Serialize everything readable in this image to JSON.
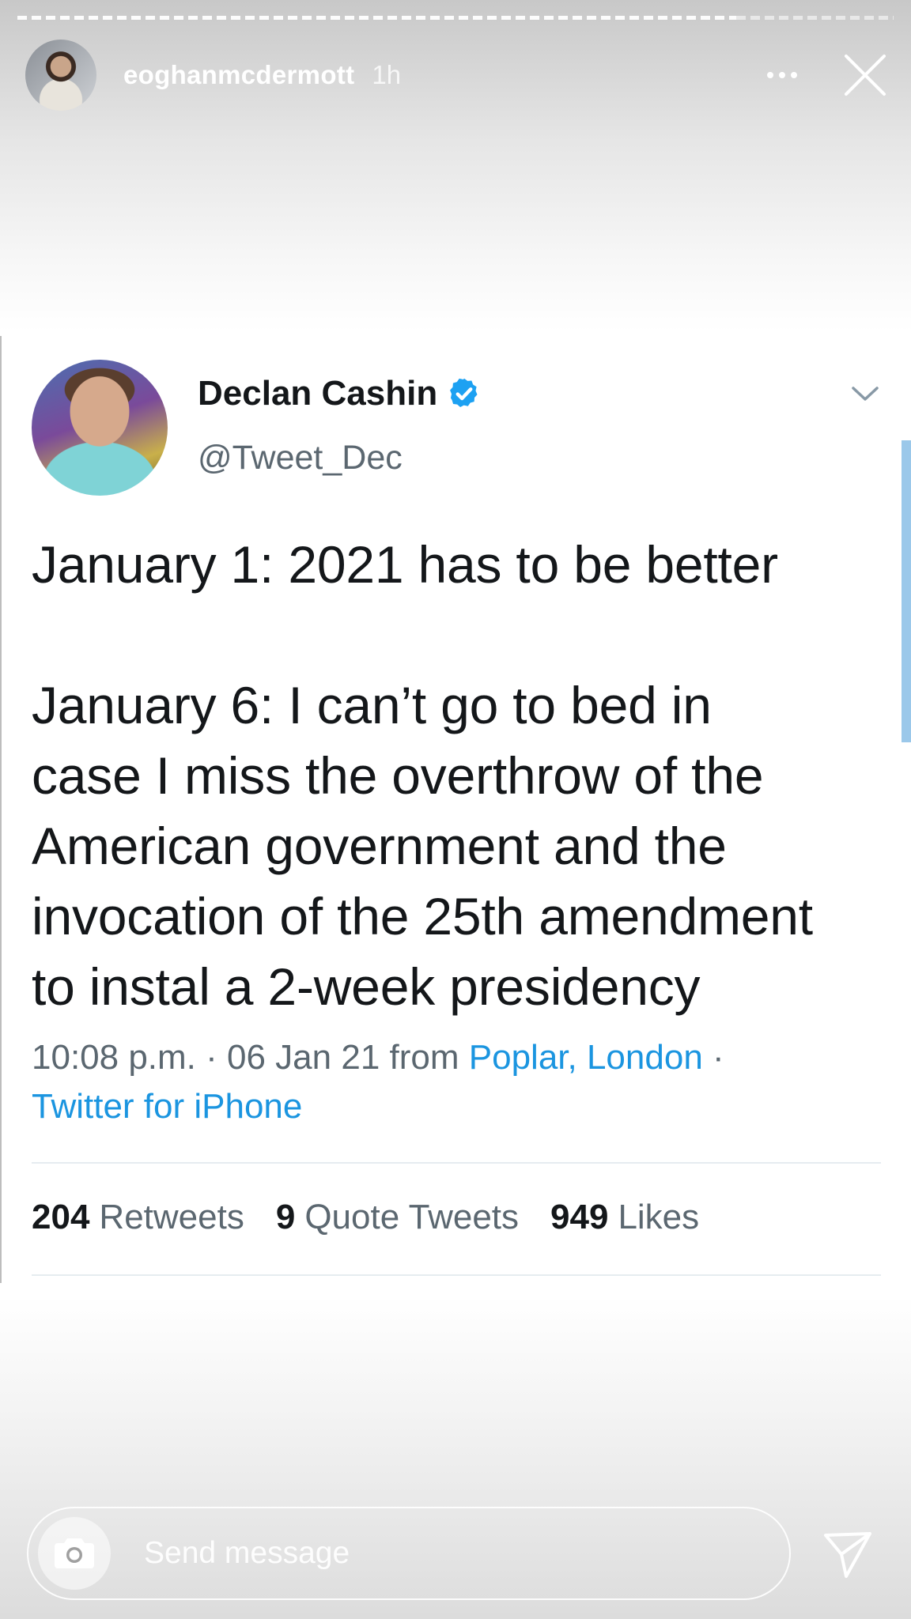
{
  "story": {
    "progress": 0.82,
    "username": "eoghanmcdermott",
    "time": "1h"
  },
  "tweet": {
    "name": "Declan Cashin",
    "handle": "@Tweet_Dec",
    "verified": true,
    "body_lines": [
      "January 1: 2021 has to be better",
      "",
      "January 6: I can’t go to bed in",
      "case I miss the overthrow of the",
      "American government and the",
      "invocation of the 25th amendment",
      "to instal a 2-week presidency"
    ],
    "meta": {
      "time": "10:08 p.m.",
      "sep1": " · ",
      "date": "06 Jan 21",
      "from": " from ",
      "location": "Poplar, London",
      "sep2": " ·",
      "source": "Twitter for iPhone"
    },
    "stats": {
      "retweets_count": "204",
      "retweets_label": "Retweets",
      "quotes_count": "9",
      "quotes_label": "Quote Tweets",
      "likes_count": "949",
      "likes_label": "Likes"
    }
  },
  "message_bar": {
    "placeholder": "Send message"
  },
  "colors": {
    "link": "#1b95e0",
    "verified": "#1da1f2",
    "text": "#14171a",
    "muted": "#5b6770"
  },
  "icons": [
    "more-icon",
    "close-icon",
    "verified-icon",
    "chevron-down-icon",
    "camera-icon",
    "send-icon"
  ]
}
